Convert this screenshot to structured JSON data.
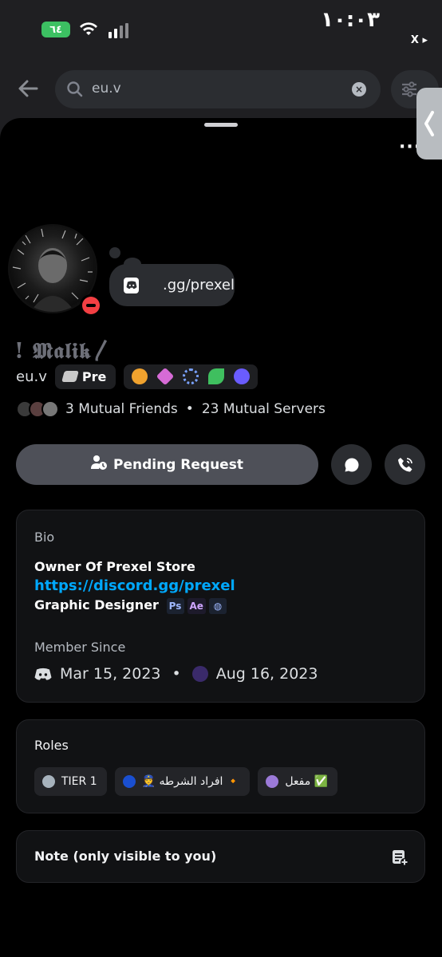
{
  "status_bar": {
    "battery": "٦٤",
    "time": "١٠:٠٣",
    "back_app": "X ▸"
  },
  "search": {
    "query": "eu.v"
  },
  "profile": {
    "bubble_status": ".gg/prexel",
    "display_name": "! 𝕸𝖆𝖑𝖎𝖐〳",
    "username": "eu.v",
    "server_tag": "Pre",
    "mutual_friends": "3 Mutual Friends",
    "mutual_servers": "23 Mutual Servers",
    "separator": "•",
    "pending_label": "Pending Request"
  },
  "bio_card": {
    "heading": "Bio",
    "line1": "Owner Of Prexel Store",
    "link": "https://discord.gg/prexel",
    "line3": "Graphic Designer",
    "app_icons": [
      "Ps",
      "Ae",
      "◍"
    ],
    "member_since_heading": "Member Since",
    "discord_since": "Mar 15, 2023",
    "server_since": "Aug 16, 2023"
  },
  "roles_card": {
    "heading": "Roles",
    "roles": [
      {
        "name": "TIER 1",
        "color": "#a7b3bd"
      },
      {
        "name": "👮 افراد الشرطه 🔸",
        "color": "#1a4fd0"
      },
      {
        "name": "مفعل ✅",
        "color": "#9b7ad8"
      }
    ]
  },
  "note_card": {
    "label": "Note (only visible to you)"
  },
  "colors": {
    "accent_link": "#00a8fc",
    "dnd": "#f23f43",
    "battery": "#3cc062"
  }
}
